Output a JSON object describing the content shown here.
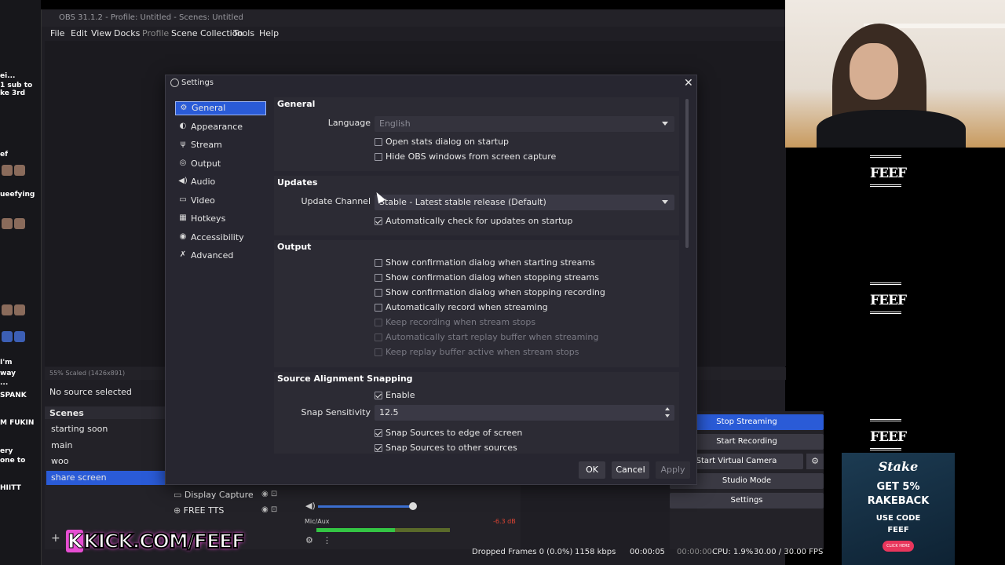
{
  "chat": {
    "lines": [
      "ei...",
      "1 sub to",
      "ke 3rd",
      "ef",
      "ueefying",
      "I'm",
      "way",
      "...",
      "SPANK",
      "M FUKIN",
      "ery",
      "one to",
      "HIITT"
    ]
  },
  "obs": {
    "title": "OBS 31.1.2 - Profile: Untitled - Scenes: Untitled",
    "menu": [
      "File",
      "Edit",
      "View",
      "Docks",
      "Profile",
      "Scene Collection",
      "Tools",
      "Help"
    ],
    "preview_status": "55%   Scaled (1426x891)",
    "no_source": "No source selected",
    "scenes_header": "Scenes",
    "scenes": [
      "starting soon",
      "main",
      "woo",
      "share screen"
    ],
    "selected_scene": "share screen",
    "sources": [
      "Display Capture",
      "FREE TTS"
    ],
    "mixer": {
      "label": "Mic/Aux",
      "db": "-6.3 dB"
    },
    "controls": [
      "Stop Streaming",
      "Start Recording",
      "Start Virtual Camera",
      "Studio Mode",
      "Settings"
    ],
    "status": {
      "dropped": "Dropped Frames 0 (0.0%)",
      "kbps": "1158 kbps",
      "stream_time": "00:00:05",
      "rec_time": "00:00:00",
      "cpu": "CPU: 1.9%",
      "fps": "30.00 / 30.00 FPS"
    }
  },
  "settings": {
    "title": "Settings",
    "nav": [
      "General",
      "Appearance",
      "Stream",
      "Output",
      "Audio",
      "Video",
      "Hotkeys",
      "Accessibility",
      "Advanced"
    ],
    "selected_nav": "General",
    "general": {
      "title": "General",
      "language_label": "Language",
      "language_value": "English",
      "open_stats": "Open stats dialog on startup",
      "hide_obs": "Hide OBS windows from screen capture"
    },
    "updates": {
      "title": "Updates",
      "channel_label": "Update Channel",
      "channel_value": "Stable - Latest stable release (Default)",
      "auto_check": "Automatically check for updates on startup"
    },
    "output": {
      "title": "Output",
      "items": [
        {
          "label": "Show confirmation dialog when starting streams",
          "checked": false,
          "disabled": false
        },
        {
          "label": "Show confirmation dialog when stopping streams",
          "checked": false,
          "disabled": false
        },
        {
          "label": "Show confirmation dialog when stopping recording",
          "checked": false,
          "disabled": false
        },
        {
          "label": "Automatically record when streaming",
          "checked": false,
          "disabled": false
        },
        {
          "label": "Keep recording when stream stops",
          "checked": false,
          "disabled": true
        },
        {
          "label": "Automatically start replay buffer when streaming",
          "checked": false,
          "disabled": true
        },
        {
          "label": "Keep replay buffer active when stream stops",
          "checked": false,
          "disabled": true
        }
      ]
    },
    "snapping": {
      "title": "Source Alignment Snapping",
      "enable": "Enable",
      "sensitivity_label": "Snap Sensitivity",
      "sensitivity_value": "12.5",
      "edge": "Snap Sources to edge of screen",
      "other": "Snap Sources to other sources"
    },
    "buttons": {
      "ok": "OK",
      "cancel": "Cancel",
      "apply": "Apply"
    }
  },
  "overlay": {
    "feef_logo": "FEEF",
    "stake": {
      "brand": "Stake",
      "line1": "GET 5%",
      "line2": "RAKEBACK",
      "code_label": "USE CODE",
      "code": "FEEF",
      "button": "CLICK HERE"
    },
    "kick_k": "K",
    "kick_text": "KICK.COM/FEEF"
  }
}
